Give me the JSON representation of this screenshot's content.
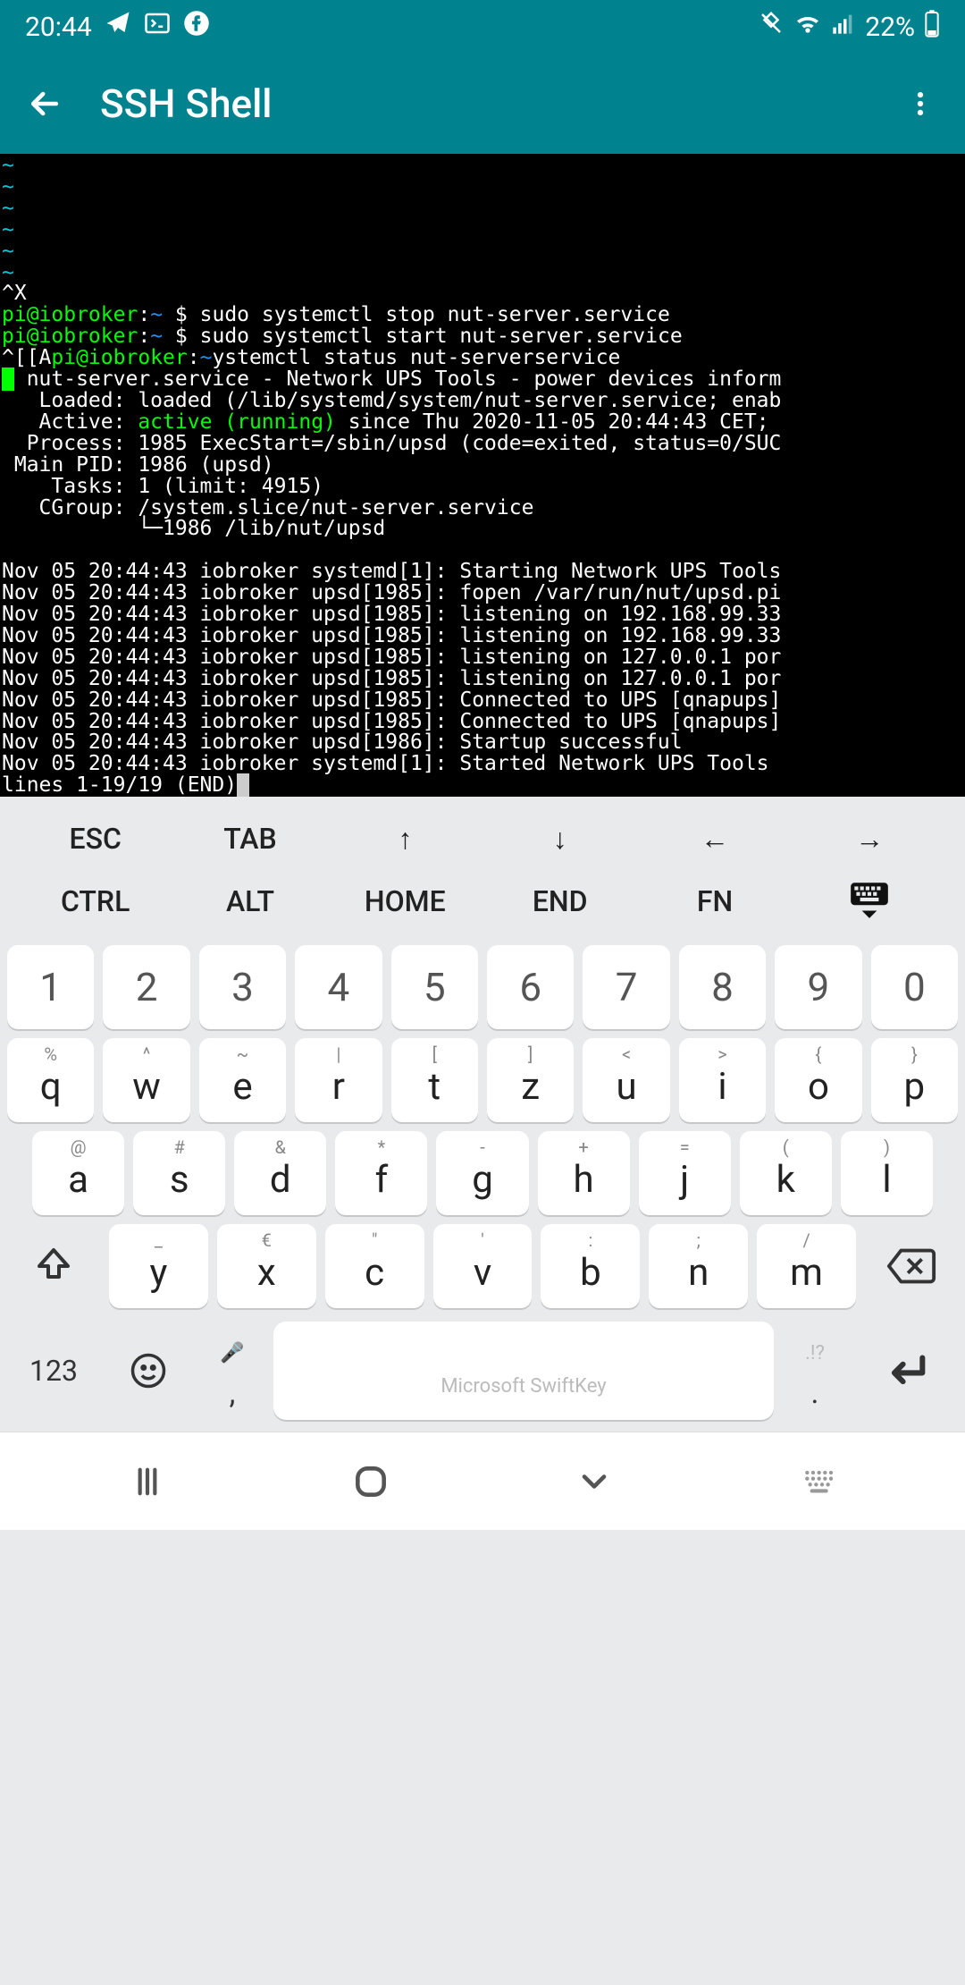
{
  "status": {
    "time": "20:44",
    "battery": "22%"
  },
  "app": {
    "title": "SSH Shell"
  },
  "terminal": {
    "tildes": [
      "~",
      "~",
      "~",
      "~",
      "~",
      "~"
    ],
    "ctrl_x": "^X",
    "prompt_user": "pi@iobroker",
    "prompt_path": "~",
    "prompt_symbol": "$",
    "cmd1": "sudo systemctl stop nut-server.service",
    "cmd2": "sudo systemctl start nut-server.service",
    "line3_pre": "^[[A",
    "line3_user": "pi@iobroker",
    "line3_mid": "ystemctl status nut-serverservice",
    "svc_head": " nut-server.service - Network UPS Tools - power devices inform",
    "loaded": "   Loaded: loaded (/lib/systemd/system/nut-server.service; enab",
    "active_lbl": "   Active: ",
    "active_val": "active (running)",
    "active_rest": " since Thu 2020-11-05 20:44:43 CET;",
    "process": "  Process: 1985 ExecStart=/sbin/upsd (code=exited, status=0/SUC",
    "mainpid": " Main PID: 1986 (upsd)",
    "tasks": "    Tasks: 1 (limit: 4915)",
    "cgroup": "   CGroup: /system.slice/nut-server.service",
    "cgroup2": "           └─1986 /lib/nut/upsd",
    "logs": [
      "Nov 05 20:44:43 iobroker systemd[1]: Starting Network UPS Tools",
      "Nov 05 20:44:43 iobroker upsd[1985]: fopen /var/run/nut/upsd.pi",
      "Nov 05 20:44:43 iobroker upsd[1985]: listening on 192.168.99.33",
      "Nov 05 20:44:43 iobroker upsd[1985]: listening on 192.168.99.33",
      "Nov 05 20:44:43 iobroker upsd[1985]: listening on 127.0.0.1 por",
      "Nov 05 20:44:43 iobroker upsd[1985]: listening on 127.0.0.1 por",
      "Nov 05 20:44:43 iobroker upsd[1985]: Connected to UPS [qnapups]",
      "Nov 05 20:44:43 iobroker upsd[1985]: Connected to UPS [qnapups]",
      "Nov 05 20:44:43 iobroker upsd[1986]: Startup successful",
      "Nov 05 20:44:43 iobroker systemd[1]: Started Network UPS Tools"
    ],
    "pager": "lines 1-19/19 (END)"
  },
  "fn": {
    "row1": [
      "ESC",
      "TAB",
      "↑",
      "↓",
      "←",
      "→"
    ],
    "row2": [
      "CTRL",
      "ALT",
      "HOME",
      "END",
      "FN",
      ""
    ]
  },
  "kb": {
    "nums": [
      "1",
      "2",
      "3",
      "4",
      "5",
      "6",
      "7",
      "8",
      "9",
      "0"
    ],
    "r1_main": [
      "q",
      "w",
      "e",
      "r",
      "t",
      "z",
      "u",
      "i",
      "o",
      "p"
    ],
    "r1_sec": [
      "%",
      "^",
      "~",
      "|",
      "[",
      "]",
      "<",
      ">",
      "{",
      "}"
    ],
    "r2_main": [
      "a",
      "s",
      "d",
      "f",
      "g",
      "h",
      "j",
      "k",
      "l"
    ],
    "r2_sec": [
      "@",
      "#",
      "&",
      "*",
      "-",
      "+",
      "=",
      "(",
      ")"
    ],
    "r3_main": [
      "y",
      "x",
      "c",
      "v",
      "b",
      "n",
      "m"
    ],
    "r3_sec": [
      "_",
      "€",
      "\"",
      "'",
      ":",
      ";",
      "/"
    ],
    "mode": "123",
    "space_brand": "Microsoft SwiftKey",
    "comma": ",",
    "period": ".",
    "mic_hint": "🎤",
    "punct_hint": ".!?"
  }
}
